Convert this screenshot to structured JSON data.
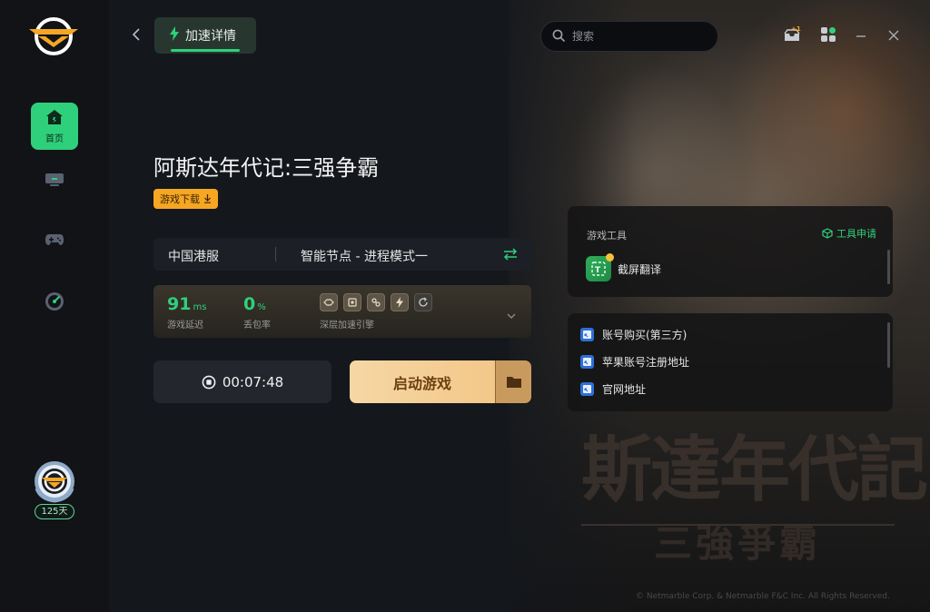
{
  "header": {
    "active_tab_label": "加速详情",
    "search_placeholder": "搜索",
    "gift_badge": "+1"
  },
  "sidebar": {
    "items": [
      {
        "label": "首页",
        "icon": "home-icon",
        "active": true
      },
      {
        "label": "",
        "icon": "monitor-icon",
        "active": false
      },
      {
        "label": "",
        "icon": "gamepad-icon",
        "active": false
      },
      {
        "label": "",
        "icon": "speedometer-icon",
        "active": false
      }
    ],
    "member_days": "125天"
  },
  "game": {
    "title": "阿斯达年代记:三强争霸",
    "download_label": "游戏下载"
  },
  "server": {
    "region": "中国港服",
    "node": "智能节点 - 进程模式一"
  },
  "stats": {
    "latency_value": "91",
    "latency_unit": "ms",
    "latency_label": "游戏延迟",
    "loss_value": "0",
    "loss_unit": "%",
    "loss_label": "丢包率",
    "engine_label": "深层加速引擎"
  },
  "actions": {
    "timer": "00:07:48",
    "launch_label": "启动游戏"
  },
  "tools": {
    "header": "游戏工具",
    "apply_label": "工具申请",
    "items": [
      {
        "label": "截屏翻译"
      }
    ]
  },
  "links": [
    {
      "label": "账号购买(第三方)"
    },
    {
      "label": "苹果账号注册地址"
    },
    {
      "label": "官网地址"
    }
  ],
  "background": {
    "title": "斯達年代記",
    "subtitle": "三強爭霸",
    "copyright": "© Netmarble Corp. & Netmarble F&C Inc. All Rights Reserved."
  },
  "colors": {
    "accent": "#2fd07b",
    "download_tag": "#f5a623",
    "launch_button": "#f3c789"
  }
}
